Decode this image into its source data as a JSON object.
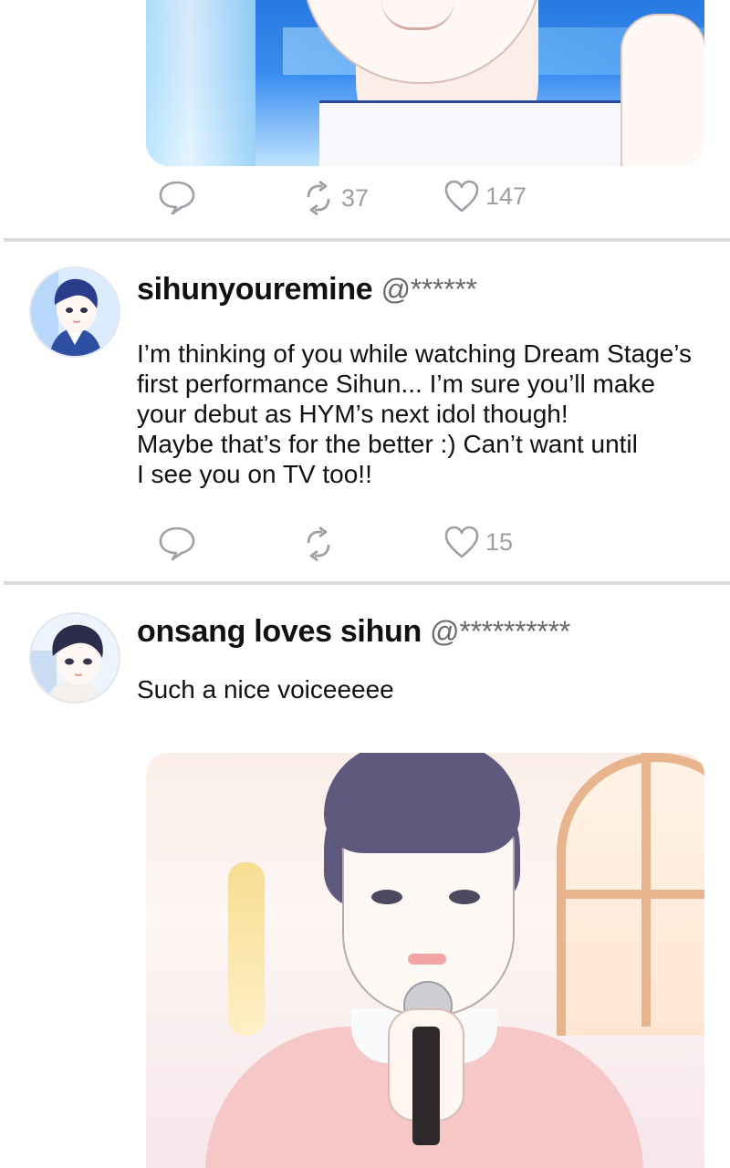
{
  "top_post": {
    "reply_count": "",
    "repost_count": "37",
    "like_count": "147"
  },
  "posts": [
    {
      "username": "sihunyouremine",
      "handle": "@******",
      "text": "I’m thinking of you while watching Dream Stage’s\nfirst performance Sihun... I’m sure you’ll make\nyour debut as HYM’s next idol though!\nMaybe that’s for the better :) Can’t want until\nI see you on TV too!!",
      "repost_count": "",
      "like_count": "15"
    },
    {
      "username": "onsang loves sihun",
      "handle": "@**********",
      "text": "Such a nice voiceeeee"
    }
  ],
  "icons": [
    "reply-icon",
    "repost-icon",
    "like-icon"
  ],
  "colors": {
    "icon": "#9aa0a6",
    "divider": "#dcdcdc"
  }
}
